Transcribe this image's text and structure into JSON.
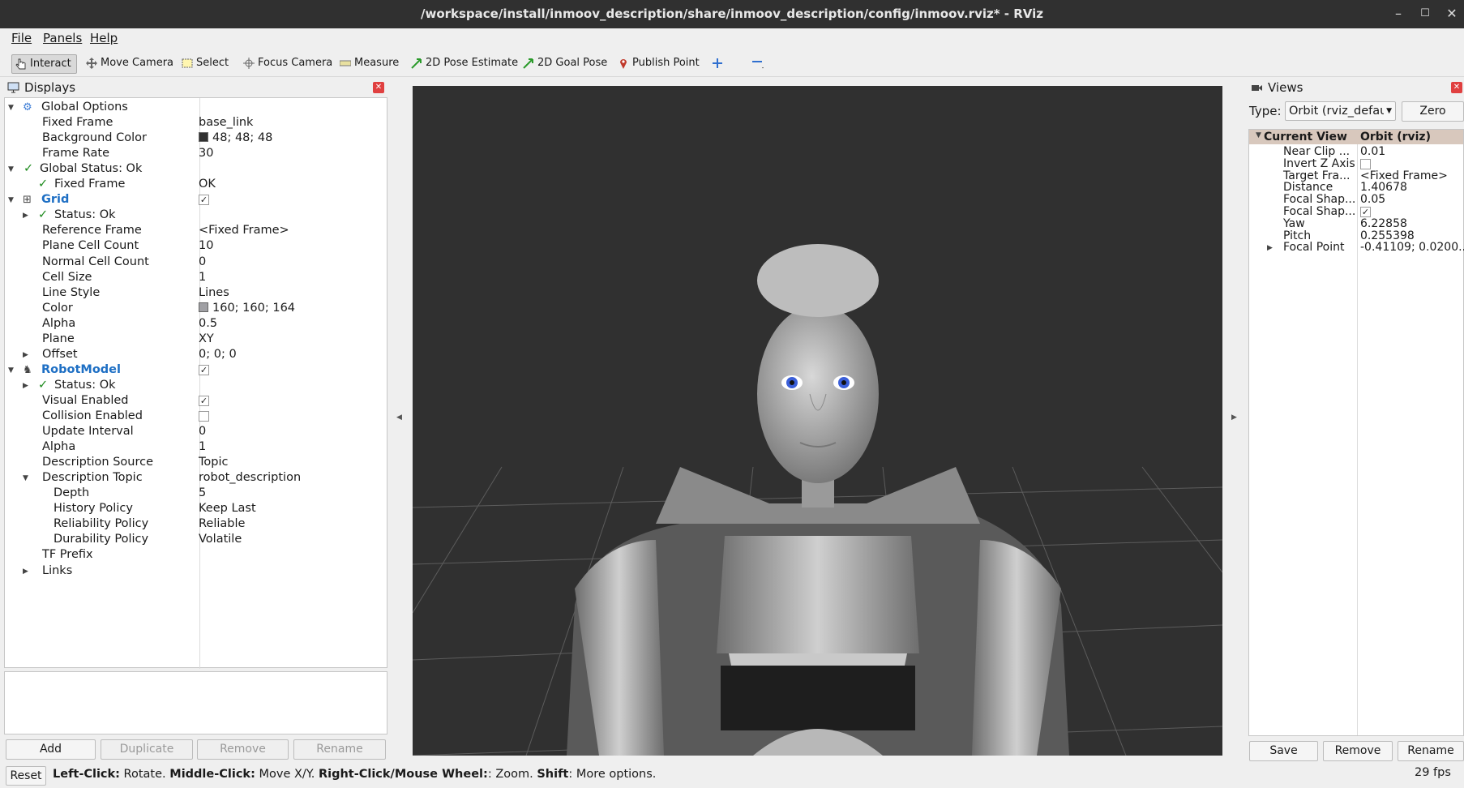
{
  "window": {
    "title": "/workspace/install/inmoov_description/share/inmoov_description/config/inmoov.rviz* - RViz"
  },
  "menu": {
    "file": "File",
    "panels": "Panels",
    "help": "Help"
  },
  "toolbar": {
    "interact": "Interact",
    "move_camera": "Move Camera",
    "select": "Select",
    "focus_camera": "Focus Camera",
    "measure": "Measure",
    "pose_estimate": "2D Pose Estimate",
    "goal_pose": "2D Goal Pose",
    "publish_point": "Publish Point"
  },
  "displays": {
    "header": "Displays",
    "rows": [
      {
        "label": "Global Options",
        "value": ""
      },
      {
        "label": "Fixed Frame",
        "value": "base_link"
      },
      {
        "label": "Background Color",
        "value": "48; 48; 48",
        "color": "#303030"
      },
      {
        "label": "Frame Rate",
        "value": "30"
      },
      {
        "label": "Global Status: Ok",
        "value": ""
      },
      {
        "label": "Fixed Frame",
        "value": "OK"
      },
      {
        "label": "Grid",
        "value": ""
      },
      {
        "label": "Status: Ok",
        "value": ""
      },
      {
        "label": "Reference Frame",
        "value": "<Fixed Frame>"
      },
      {
        "label": "Plane Cell Count",
        "value": "10"
      },
      {
        "label": "Normal Cell Count",
        "value": "0"
      },
      {
        "label": "Cell Size",
        "value": "1"
      },
      {
        "label": "Line Style",
        "value": "Lines"
      },
      {
        "label": "Color",
        "value": "160; 160; 164",
        "color": "#a0a0a4"
      },
      {
        "label": "Alpha",
        "value": "0.5"
      },
      {
        "label": "Plane",
        "value": "XY"
      },
      {
        "label": "Offset",
        "value": "0; 0; 0"
      },
      {
        "label": "RobotModel",
        "value": ""
      },
      {
        "label": "Status: Ok",
        "value": ""
      },
      {
        "label": "Visual Enabled",
        "value": ""
      },
      {
        "label": "Collision Enabled",
        "value": ""
      },
      {
        "label": "Update Interval",
        "value": "0"
      },
      {
        "label": "Alpha",
        "value": "1"
      },
      {
        "label": "Description Source",
        "value": "Topic"
      },
      {
        "label": "Description Topic",
        "value": "robot_description"
      },
      {
        "label": "Depth",
        "value": "5"
      },
      {
        "label": "History Policy",
        "value": "Keep Last"
      },
      {
        "label": "Reliability Policy",
        "value": "Reliable"
      },
      {
        "label": "Durability Policy",
        "value": "Volatile"
      },
      {
        "label": "TF Prefix",
        "value": ""
      },
      {
        "label": "Links",
        "value": ""
      }
    ],
    "buttons": {
      "add": "Add",
      "duplicate": "Duplicate",
      "remove": "Remove",
      "rename": "Rename"
    }
  },
  "views": {
    "header": "Views",
    "type_label": "Type:",
    "type_value": "Orbit (rviz_defau",
    "zero": "Zero",
    "col1": "Current View",
    "col2": "Orbit (rviz)",
    "rows": [
      {
        "label": "Near Clip ...",
        "value": "0.01"
      },
      {
        "label": "Invert Z Axis",
        "value": ""
      },
      {
        "label": "Target Fra...",
        "value": "<Fixed Frame>"
      },
      {
        "label": "Distance",
        "value": "1.40678"
      },
      {
        "label": "Focal Shap...",
        "value": "0.05"
      },
      {
        "label": "Focal Shap...",
        "value": ""
      },
      {
        "label": "Yaw",
        "value": "6.22858"
      },
      {
        "label": "Pitch",
        "value": "0.255398"
      },
      {
        "label": "Focal Point",
        "value": "-0.41109; 0.0200..."
      }
    ],
    "buttons": {
      "save": "Save",
      "remove": "Remove",
      "rename": "Rename"
    }
  },
  "status": {
    "reset": "Reset",
    "k1": "Left-Click:",
    "t1": " Rotate. ",
    "k2": "Middle-Click:",
    "t2": " Move X/Y. ",
    "k3": "Right-Click/Mouse Wheel:",
    "t3": ": Zoom. ",
    "k4": "Shift",
    "t4": ": More options.",
    "fps": "29 fps"
  }
}
